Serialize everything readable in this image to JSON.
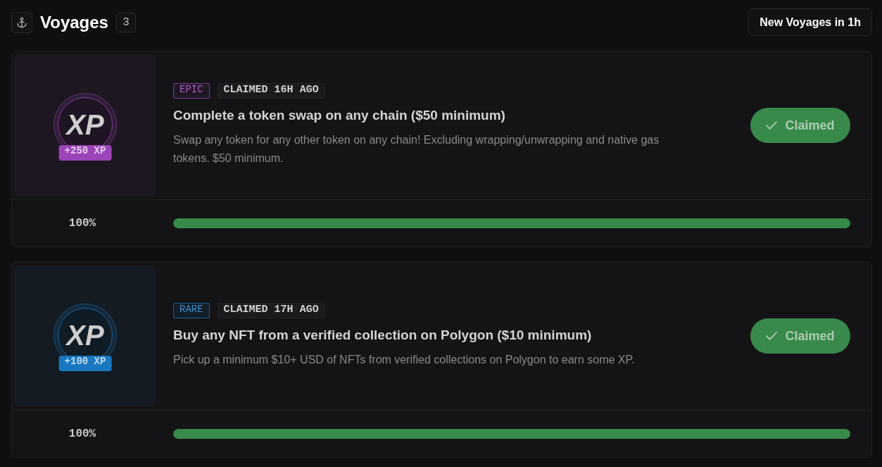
{
  "header": {
    "title": "Voyages",
    "count": "3",
    "action": "New Voyages in 1h"
  },
  "voyages": [
    {
      "rarity": "EPIC",
      "color": "#9a44b8",
      "status": "CLAIMED 16H AGO",
      "logo": "XP",
      "reward": "+250 XP",
      "title": "Complete a token swap on any chain ($50 minimum)",
      "description": "Swap any token for any other token on any chain! Excluding wrapping/unwrapping and native gas tokens. $50 minimum.",
      "button": {
        "label": "Claimed",
        "claimed": true
      },
      "progress": {
        "reading": "100%",
        "level": 1
      }
    },
    {
      "rarity": "RARE",
      "color": "#1878c0",
      "status": "CLAIMED 17H AGO",
      "logo": "XP",
      "reward": "+100 XP",
      "title": "Buy any NFT from a verified collection on Polygon ($10 minimum)",
      "description": "Pick up a minimum $10+ USD of NFTs from verified collections on Polygon to earn some XP.",
      "button": {
        "label": "Claimed",
        "claimed": true
      },
      "progress": {
        "reading": "100%",
        "level": 1
      }
    }
  ]
}
